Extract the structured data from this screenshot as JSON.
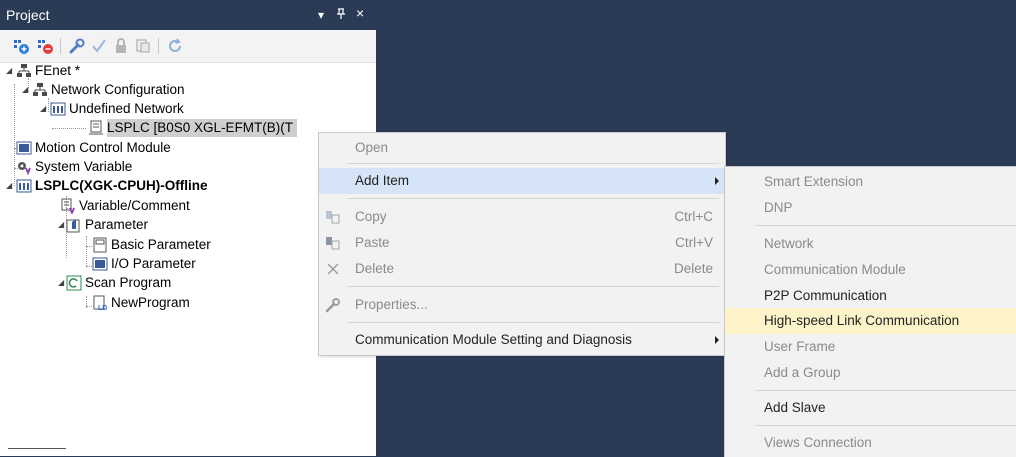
{
  "panel": {
    "title": "Project",
    "pin": "ᵖ",
    "close": "×"
  },
  "tree": {
    "root": "FEnet *",
    "network_config": "Network Configuration",
    "undefined_network": "Undefined Network",
    "lsplc_module": "LSPLC [B0S0 XGL-EFMT(B)(T",
    "motion_control": "Motion Control Module",
    "system_variable": "System Variable",
    "lsplc_cpu": "LSPLC(XGK-CPUH)-Offline",
    "variable_comment": "Variable/Comment",
    "parameter": "Parameter",
    "basic_parameter": "Basic Parameter",
    "io_parameter": "I/O Parameter",
    "scan_program": "Scan Program",
    "new_program": "NewProgram"
  },
  "context_menu": {
    "open": "Open",
    "add_item": "Add Item",
    "copy": "Copy",
    "copy_key": "Ctrl+C",
    "paste": "Paste",
    "paste_key": "Ctrl+V",
    "delete": "Delete",
    "delete_key": "Delete",
    "properties": "Properties...",
    "comm_module_setting": "Communication Module Setting and Diagnosis"
  },
  "submenu": {
    "smart_extension": "Smart Extension",
    "dnp": "DNP",
    "network": "Network",
    "communication_module": "Communication Module",
    "p2p": "P2P Communication",
    "highspeed_link": "High-speed Link Communication",
    "user_frame": "User Frame",
    "add_group": "Add a Group",
    "add_slave": "Add Slave",
    "views_connection": "Views Connection"
  },
  "colors": {
    "background": "#2b3a55",
    "menu_bg": "#f2f2f2",
    "highlight": "#fdf3c9",
    "hover": "#d6e4f7"
  }
}
